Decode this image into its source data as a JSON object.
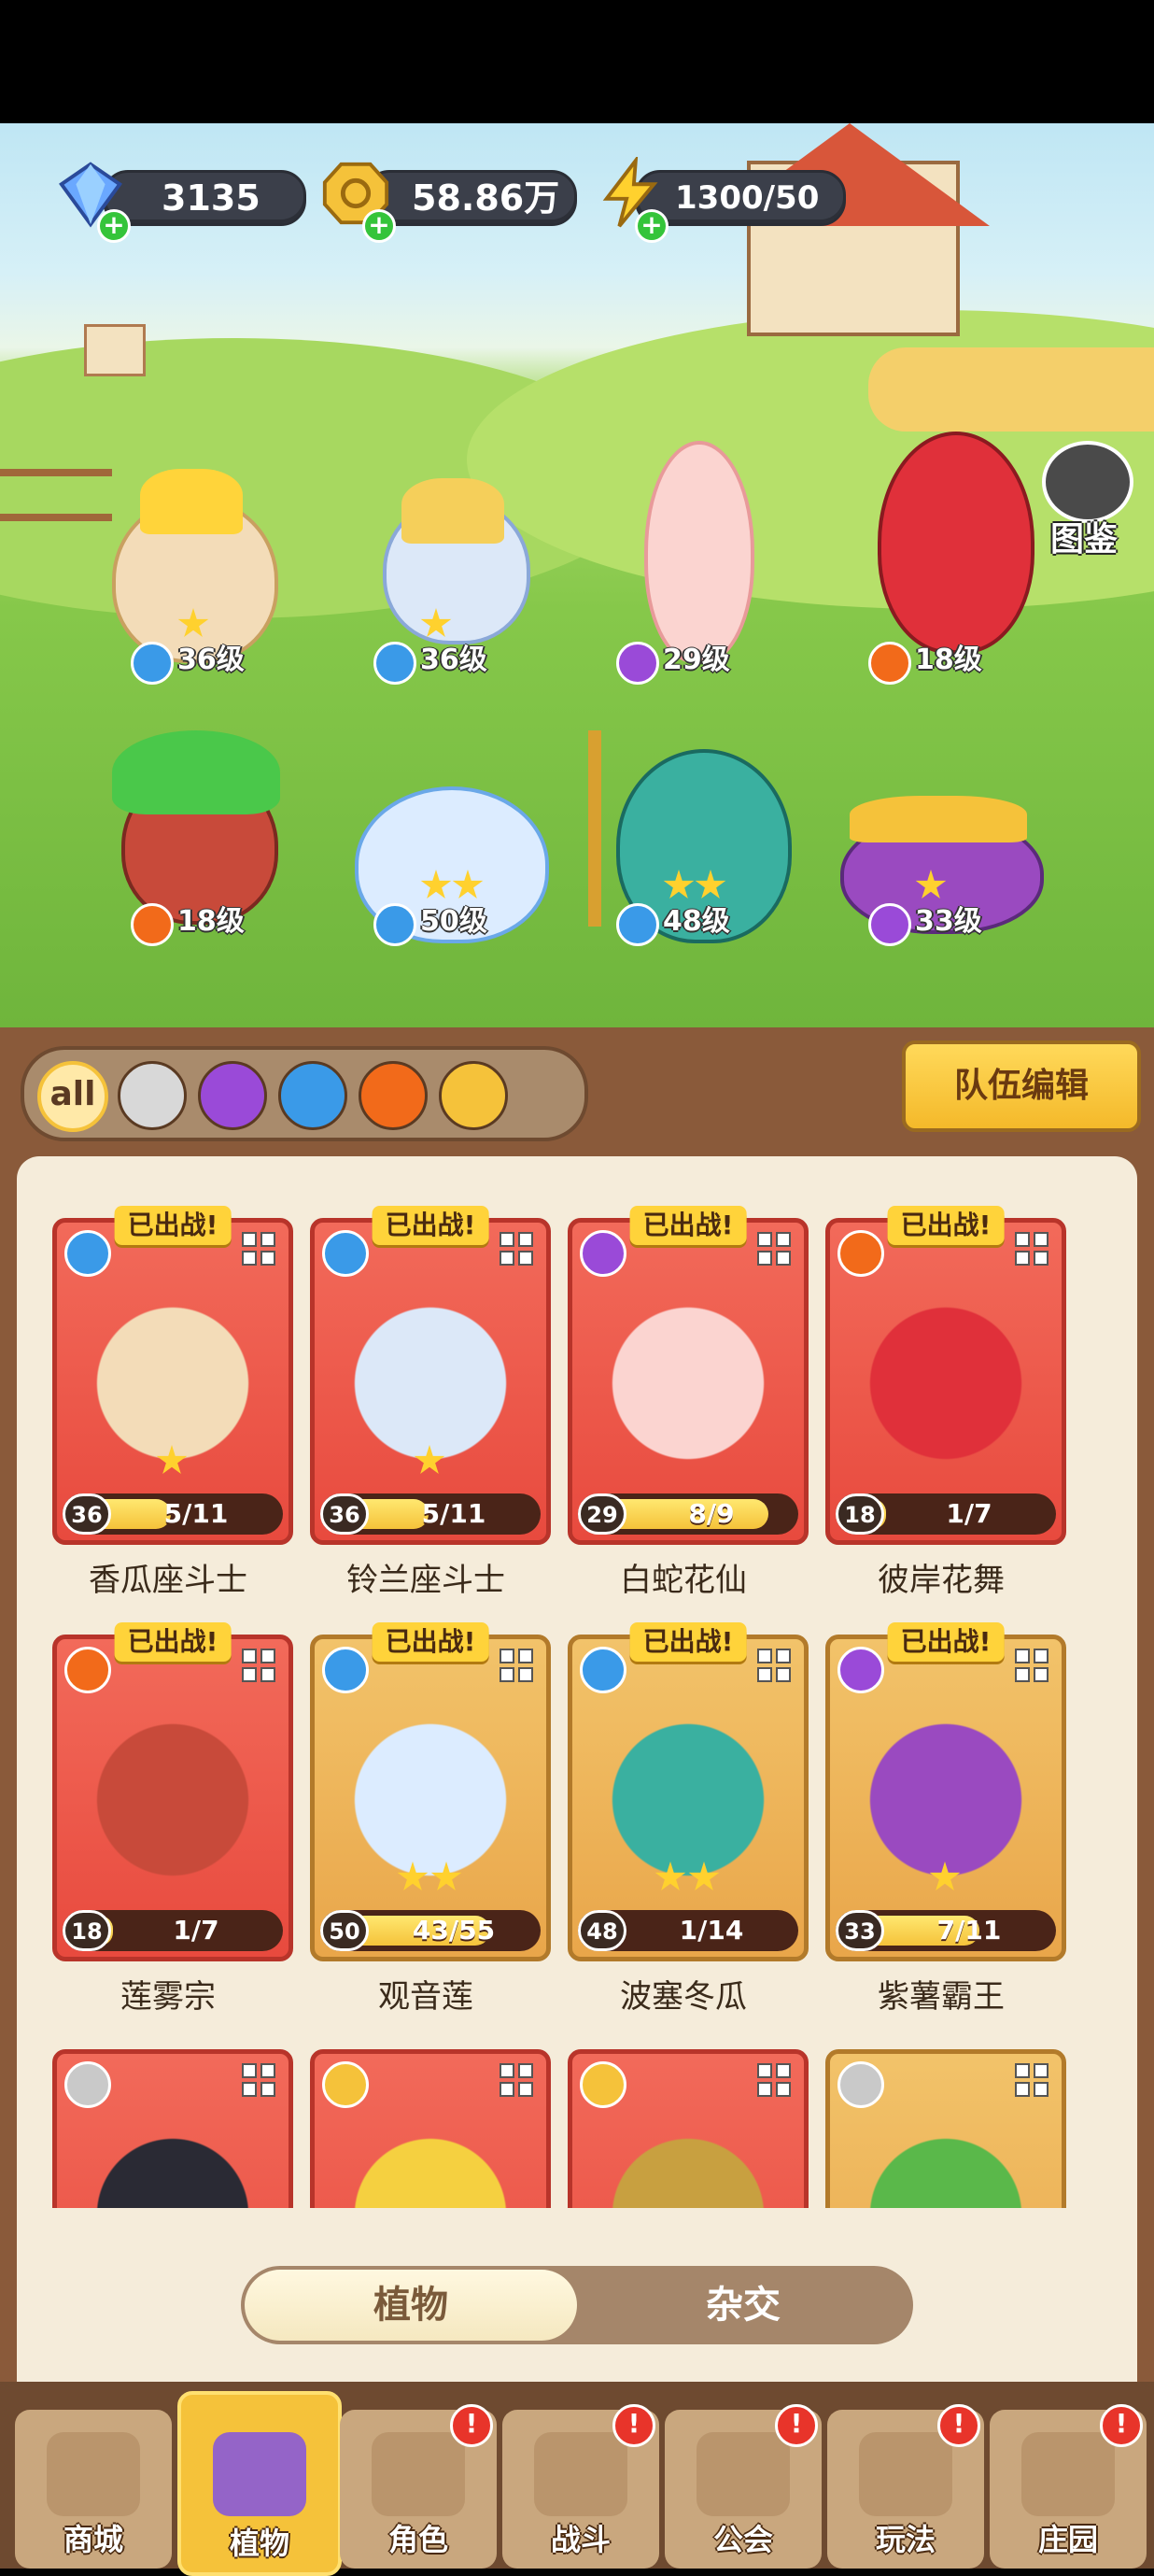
{
  "resources": {
    "gems": {
      "value": "3135",
      "icon": "gem-icon"
    },
    "gold": {
      "value": "58.86万",
      "icon": "gold-coin-icon"
    },
    "energy": {
      "value": "1300/50",
      "icon": "lightning-icon"
    }
  },
  "codex_button": {
    "label": "图鉴",
    "icon": "codex-book-icon"
  },
  "field_units": [
    {
      "name": "香瓜座斗士",
      "level": "36级",
      "element": "water",
      "stars": 1
    },
    {
      "name": "铃兰座斗士",
      "level": "36级",
      "element": "water",
      "stars": 1
    },
    {
      "name": "白蛇花仙",
      "level": "29级",
      "element": "poison",
      "stars": 0
    },
    {
      "name": "彼岸花舞",
      "level": "18级",
      "element": "fire",
      "stars": 0
    },
    {
      "name": "莲雾宗",
      "level": "18级",
      "element": "fire",
      "stars": 0
    },
    {
      "name": "观音莲",
      "level": "50级",
      "element": "water",
      "stars": 2
    },
    {
      "name": "波塞冬瓜",
      "level": "48级",
      "element": "water",
      "stars": 2
    },
    {
      "name": "紫薯霸王",
      "level": "33级",
      "element": "poison",
      "stars": 1
    }
  ],
  "filters": [
    {
      "label": "all",
      "icon": "all-filter-icon",
      "selected": true
    },
    {
      "icon": "sword-filter-icon"
    },
    {
      "icon": "poison-filter-icon"
    },
    {
      "icon": "water-filter-icon"
    },
    {
      "icon": "fire-filter-icon"
    },
    {
      "icon": "lightning-filter-icon"
    }
  ],
  "team_edit_label": "队伍编辑",
  "deployed_badge": "已出战!",
  "cards": [
    {
      "name": "香瓜座斗士",
      "level": "36",
      "progress": "5/11",
      "ratio": 0.45,
      "element": "water",
      "frame": "red",
      "deployed": true,
      "stars": 1
    },
    {
      "name": "铃兰座斗士",
      "level": "36",
      "progress": "5/11",
      "ratio": 0.45,
      "element": "water",
      "frame": "red",
      "deployed": true,
      "stars": 1
    },
    {
      "name": "白蛇花仙",
      "level": "29",
      "progress": "8/9",
      "ratio": 0.89,
      "element": "poison",
      "frame": "red",
      "deployed": true,
      "stars": 0
    },
    {
      "name": "彼岸花舞",
      "level": "18",
      "progress": "1/7",
      "ratio": 0.14,
      "element": "fire",
      "frame": "red",
      "deployed": true,
      "stars": 0
    },
    {
      "name": "莲雾宗",
      "level": "18",
      "progress": "1/7",
      "ratio": 0.14,
      "element": "fire",
      "frame": "red",
      "deployed": true,
      "stars": 0
    },
    {
      "name": "观音莲",
      "level": "50",
      "progress": "43/55",
      "ratio": 0.78,
      "element": "water",
      "frame": "gold",
      "deployed": true,
      "stars": 2
    },
    {
      "name": "波塞冬瓜",
      "level": "48",
      "progress": "1/14",
      "ratio": 0.07,
      "element": "water",
      "frame": "gold",
      "deployed": true,
      "stars": 2
    },
    {
      "name": "紫薯霸王",
      "level": "33",
      "progress": "7/11",
      "ratio": 0.64,
      "element": "poison",
      "frame": "gold",
      "deployed": true,
      "stars": 1
    },
    {
      "element": "sword",
      "frame": "red",
      "deployed": false
    },
    {
      "element": "lightning",
      "frame": "red",
      "deployed": false
    },
    {
      "element": "lightning",
      "frame": "red",
      "deployed": false
    },
    {
      "element": "sword",
      "frame": "gold",
      "deployed": false
    }
  ],
  "toggle": {
    "left": "植物",
    "right": "杂交",
    "selected": "left"
  },
  "nav": [
    {
      "label": "商城",
      "icon": "shop-icon",
      "alert": false
    },
    {
      "label": "植物",
      "icon": "plant-icon",
      "alert": false,
      "active": true
    },
    {
      "label": "角色",
      "icon": "character-icon",
      "alert": true
    },
    {
      "label": "战斗",
      "icon": "battle-icon",
      "alert": true
    },
    {
      "label": "公会",
      "icon": "guild-icon",
      "alert": true
    },
    {
      "label": "玩法",
      "icon": "gameplay-icon",
      "alert": true
    },
    {
      "label": "庄园",
      "icon": "manor-icon",
      "alert": true
    }
  ],
  "alert_mark": "!",
  "colors": {
    "water": "#3a9ae8",
    "fire": "#f26a1a",
    "poison": "#9a4ad8",
    "lightning": "#f5c23a",
    "sword": "#c9c9c9"
  }
}
